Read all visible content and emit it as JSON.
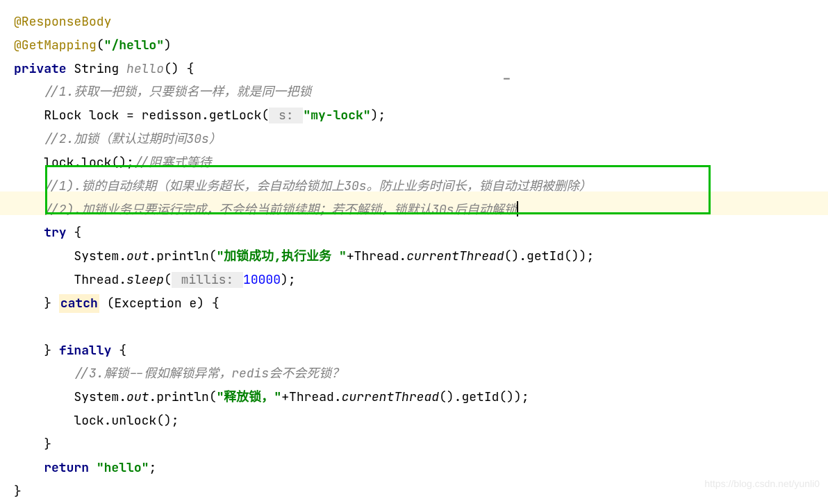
{
  "annotations": {
    "responseBody": "@ResponseBody",
    "getMapping": "@GetMapping",
    "getMappingArg": "\"/hello\""
  },
  "signature": {
    "private": "private",
    "returnType": "String",
    "methodName": "hello",
    "parensOpen": "() {"
  },
  "comments": {
    "c1": "//1.获取一把锁，只要锁名一样，就是同一把锁",
    "c2": "//2.加锁（默认过期时间30s）",
    "cBlock": "//阻塞式等待",
    "cBox1": "//1).锁的自动续期（如果业务超长，会自动给锁加上30s。防止业务时间长，锁自动过期被删除）",
    "cBox2": "//2).加锁业务只要运行完成，不会给当前锁续期；若不解锁，锁默认30s后自动解锁",
    "c3": "//3.解锁--假如解锁异常，redis会不会死锁？"
  },
  "code": {
    "rlockDecl": "RLock lock = redisson.getLock(",
    "paramHintS": " s: ",
    "myLockStr": "\"my-lock\"",
    "getLockEnd": ");",
    "lockCall": "lock.lock();",
    "tryOpen": "try",
    "braceOpen": " {",
    "systemOut1a": "System.",
    "out": "out",
    "println1b": ".println(",
    "str1": "\"加锁成功,执行业务 \"",
    "plus1": "+Thread.",
    "currentThread": "currentThread",
    "getId1": "().getId());",
    "threadSleep1": "Thread.",
    "sleep": "sleep",
    "sleepOpen": "(",
    "paramHintMillis": " millis: ",
    "sleepVal": "10000",
    "sleepEnd": ");",
    "braceClose1": "}",
    "catch": "catch",
    "catchArgs": " (Exception e) {",
    "finally": "finally",
    "finallyOpen": " {",
    "str2": "\"释放锁，\"",
    "plus2": "+Thread.",
    "getId2": "().getId());",
    "unlockCall": "lock.unlock();",
    "braceClose2": "}",
    "returnKw": "return",
    "returnVal": "\"hello\"",
    "semiColon": ";",
    "methodEnd": "}"
  },
  "watermark": "https://blog.csdn.net/yunli0",
  "dashMark": "_"
}
